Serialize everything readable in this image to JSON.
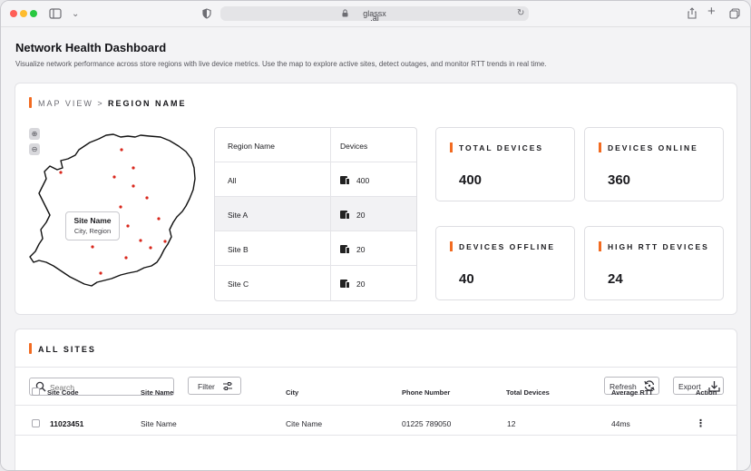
{
  "browser": {
    "url_line1": "glassx",
    "url_line2": ".ai"
  },
  "header": {
    "title": "Network Health Dashboard",
    "subtitle": "Visualize network performance across store regions with live device metrics. Use the map to explore active sites, detect outages, and monitor RTT trends in real time."
  },
  "map_view": {
    "label": "MAP VIEW >",
    "region_label": "REGION NAME",
    "tooltip_title": "Site Name",
    "tooltip_sub": "City, Region",
    "zoom_in": "⊕",
    "zoom_out": "⊖"
  },
  "region_table": {
    "headers": [
      "Region Name",
      "Devices"
    ],
    "rows": [
      {
        "name": "All",
        "devices": "400"
      },
      {
        "name": "Site A",
        "devices": "20"
      },
      {
        "name": "Site B",
        "devices": "20"
      },
      {
        "name": "Site C",
        "devices": "20"
      }
    ]
  },
  "stats": [
    {
      "label": "TOTAL DEVICES",
      "value": "400"
    },
    {
      "label": "DEVICES ONLINE",
      "value": "360"
    },
    {
      "label": "DEVICES OFFLINE",
      "value": "40"
    },
    {
      "label": "HIGH RTT DEVICES",
      "value": "24"
    }
  ],
  "all_sites": {
    "label": "ALL SITES",
    "search_placeholder": "Search",
    "filter_label": "Filter",
    "refresh_label": "Refresh",
    "export_label": "Export",
    "columns": [
      "Site Code",
      "Site Name",
      "City",
      "Phone Number",
      "Total Devices",
      "Average RTT",
      "Action"
    ],
    "rows": [
      {
        "code": "11023451",
        "name": "Site Name",
        "city": "Cite Name",
        "phone": "01225 789050",
        "devices": "12",
        "rtt": "44ms",
        "action": "⋮"
      }
    ]
  },
  "colors": {
    "accent": "#f26b21",
    "map_dot": "#d9271c"
  }
}
